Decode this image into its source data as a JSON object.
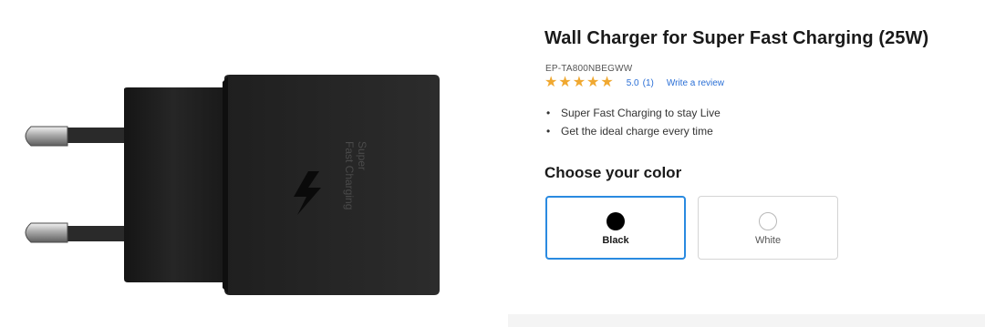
{
  "product": {
    "title": "Wall Charger for Super Fast Charging (25W)",
    "sku": "EP-TA800NBEGWW",
    "image": {
      "charger_text_line1": "Super",
      "charger_text_line2": "Fast Charging",
      "body_color": "#1e1e1e"
    }
  },
  "rating": {
    "stars": 5,
    "score": "5.0",
    "count": "(1)",
    "write_review": "Write a review",
    "star_color": "#f0a830"
  },
  "features": [
    "Super Fast Charging to stay Live",
    "Get the ideal charge every time"
  ],
  "color_selector": {
    "heading": "Choose your color",
    "options": [
      {
        "label": "Black",
        "color": "#000000",
        "selected": true
      },
      {
        "label": "White",
        "color": "#ffffff",
        "selected": false
      }
    ],
    "selected_border_color": "#2a8ae0"
  },
  "theme": {
    "link_color": "#2a6fd6"
  }
}
